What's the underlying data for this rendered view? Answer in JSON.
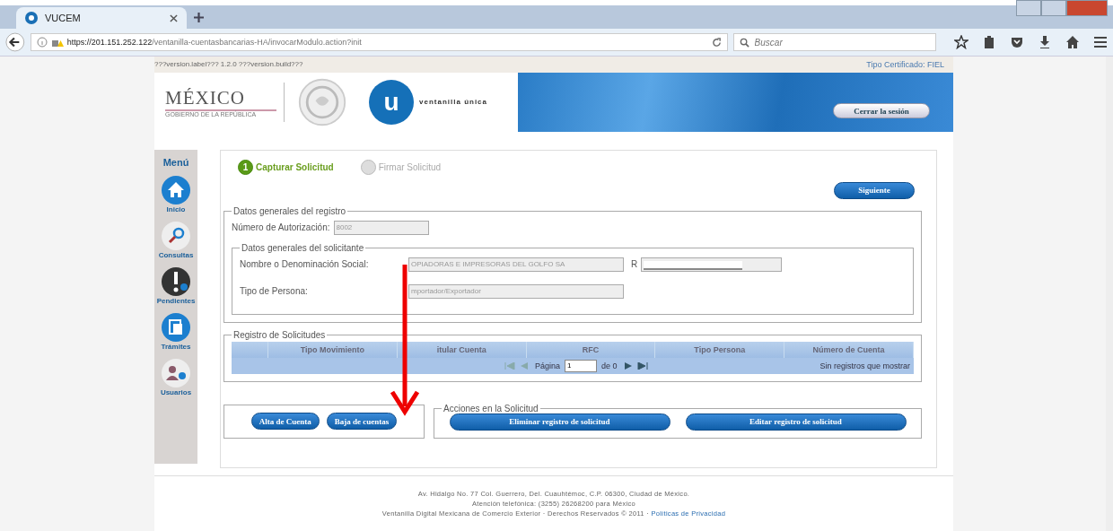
{
  "browser": {
    "tab": {
      "title": "VUCEM"
    },
    "url": {
      "host": "https://201.151.252.122",
      "path": "/ventanilla-cuentasbancarias-HA/invocarModulo.action?init"
    },
    "search": {
      "placeholder": "Buscar"
    }
  },
  "page": {
    "version": "???version.label??? 1.2.0 ???version.build???",
    "certificate": "Tipo Certificado: FIEL",
    "header": {
      "logo_title": "MÉXICO",
      "logo_subtitle": "GOBIERNO DE LA REPÚBLICA",
      "brand_letter": "u",
      "brand_name": "ventanilla única",
      "logout": "Cerrar la sesión"
    },
    "menu": {
      "title": "Menú",
      "items": [
        {
          "label": "Inicio",
          "kind": "home"
        },
        {
          "label": "Consultas",
          "kind": "search"
        },
        {
          "label": "Pendientes",
          "kind": "alert"
        },
        {
          "label": "Trámites",
          "kind": "document"
        },
        {
          "label": "Usuarios",
          "kind": "users"
        }
      ]
    },
    "steps": [
      {
        "number": "1",
        "label": "Capturar Solicitud",
        "selected": true
      },
      {
        "label": "Firmar Solicitud",
        "selected": false
      }
    ],
    "next_button": "Siguiente",
    "registro": {
      "legend": "Datos generales del registro",
      "auth_label": "Número de Autorización:",
      "auth_value": "8002"
    },
    "solicitante": {
      "legend": "Datos generales del solicitante",
      "name_label": "Nombre o Denominación Social:",
      "name_value": "OPIADORAS E IMPRESORAS DEL GOLFO SA",
      "rfc_label": "R",
      "type_label": "Tipo de Persona:",
      "type_value": "mportador/Exportador"
    },
    "solicitudes": {
      "legend": "Registro de Solicitudes",
      "columns": [
        "Tipo Movimiento",
        "itular Cuenta",
        "RFC",
        "Tipo Persona",
        "Número de Cuenta"
      ],
      "pager": {
        "page_label": "Página",
        "page_value": "1",
        "of": "de 0",
        "status": "Sin registros que mostrar"
      }
    },
    "account_buttons": [
      "Alta de Cuenta",
      "Baja de cuentas"
    ],
    "acciones": {
      "legend": "Acciones en la Solicitud",
      "buttons": [
        "Eliminar registro de solicitud",
        "Editar registro de solicitud"
      ]
    },
    "footer": {
      "lines": [
        "Av. Hidalgo No. 77 Col. Guerrero, Del. Cuauhtémoc, C.P. 06300, Ciudad de México.",
        "Atención telefónica: (3255) 26268200 para México"
      ],
      "copyright": "Ventanilla Digital Mexicana de Comercio Exterior · Derechos Reservados © 2011 ·",
      "privacy_link": "Políticas de Privacidad"
    }
  }
}
